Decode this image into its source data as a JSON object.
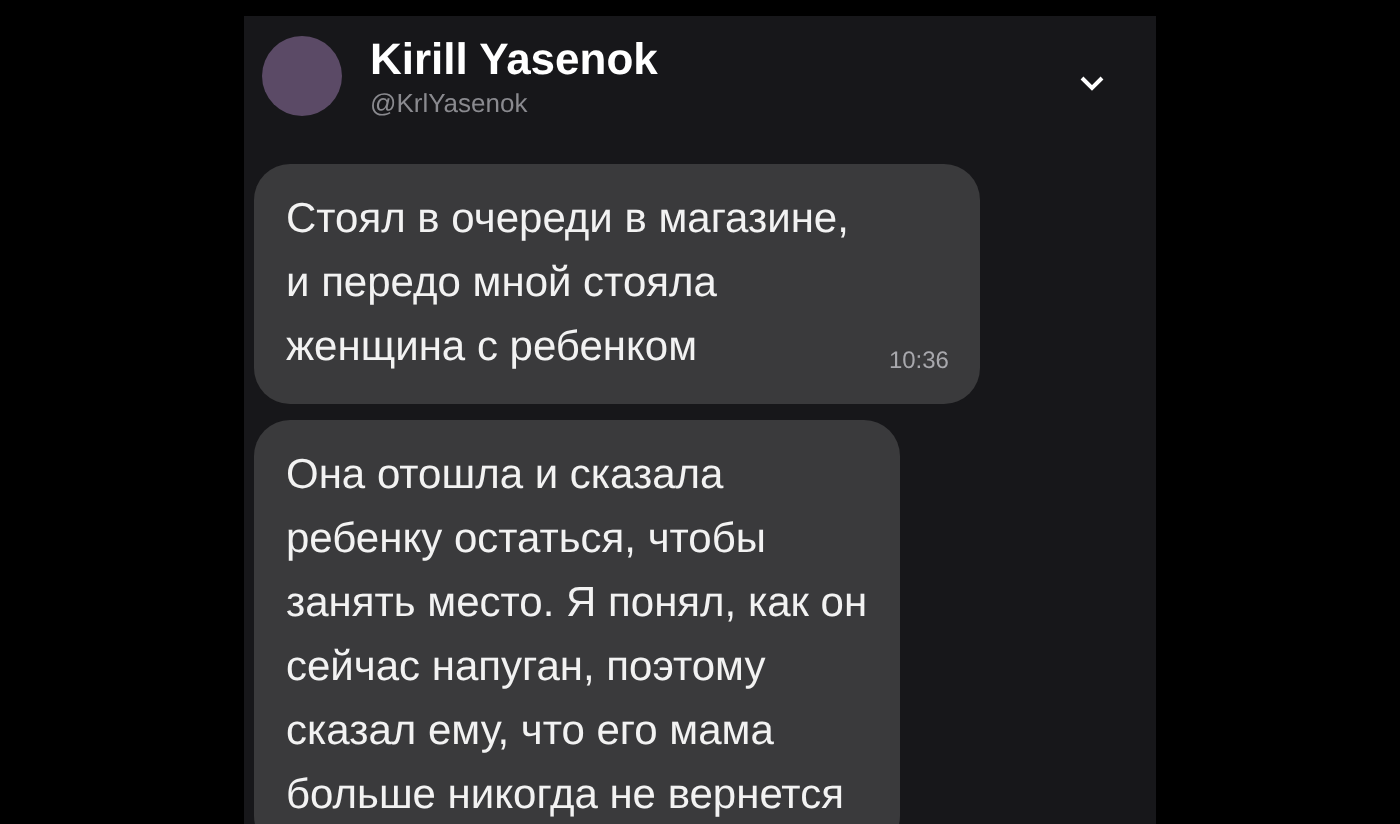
{
  "tweet": {
    "author": {
      "name": "Kirill Yasenok",
      "handle": "@KrlYasenok"
    },
    "messages": [
      {
        "text": "Стоял в очереди в магазине,\nи передо мной стояла\nженщина с ребенком",
        "time": "10:36"
      },
      {
        "text": "Она отошла и сказала\nребенку остаться, чтобы\nзанять место. Я понял, как он\nсейчас напуган, поэтому\nсказал ему, что его мама\nбольше никогда не вернется"
      }
    ]
  }
}
